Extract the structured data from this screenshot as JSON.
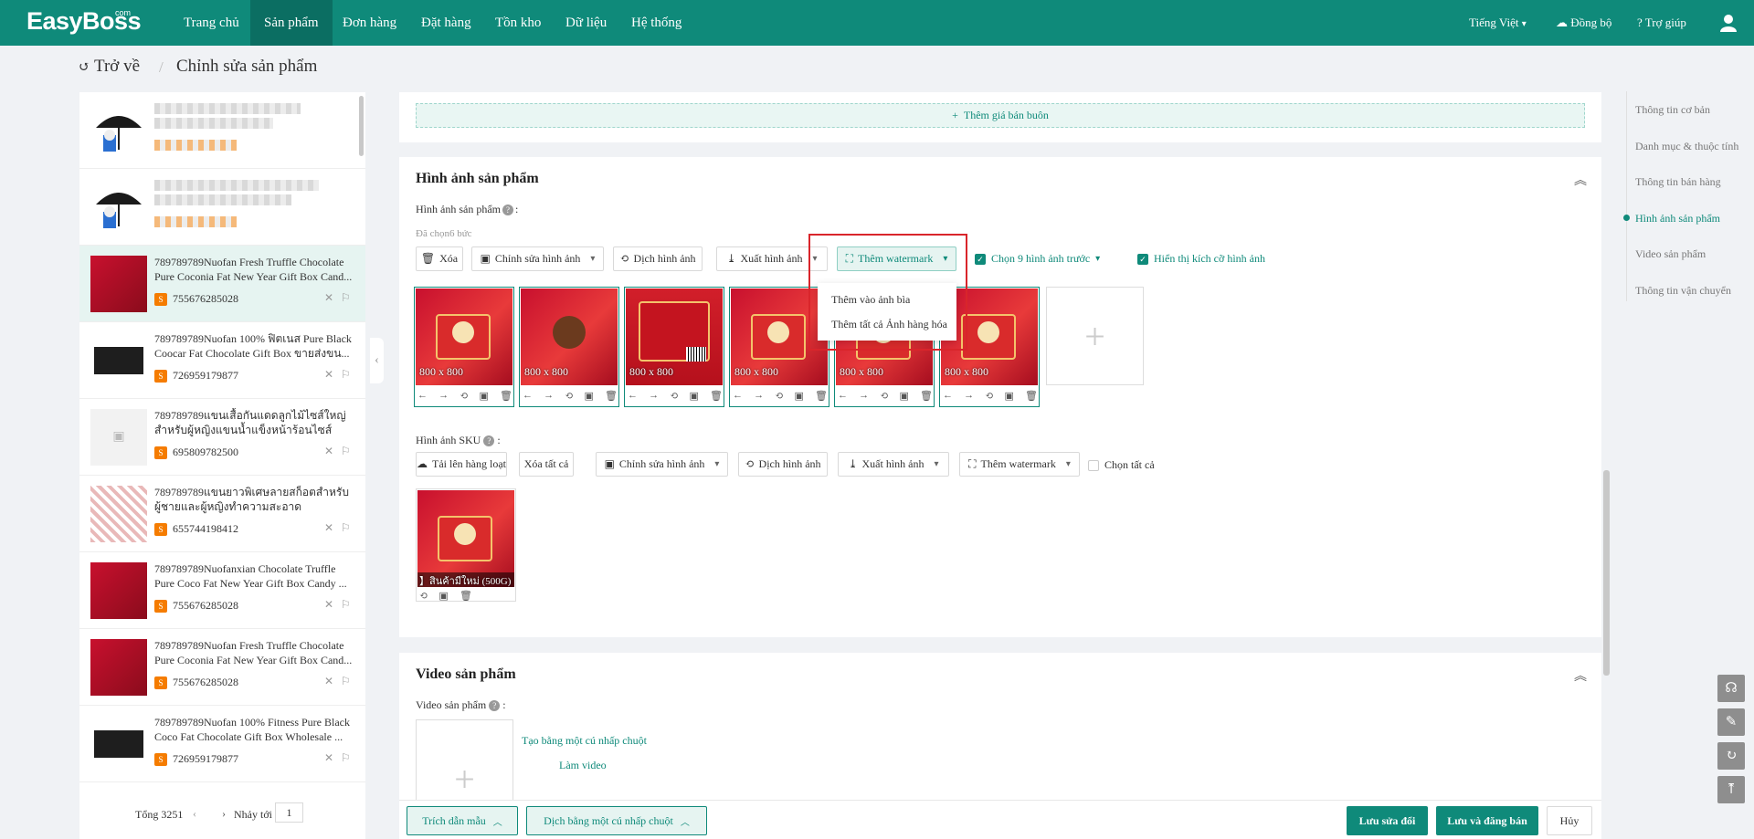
{
  "app": {
    "logo": "EasyBoss",
    "logo_suffix": "com",
    "nav": [
      "Trang chủ",
      "Sản phẩm",
      "Đơn hàng",
      "Đặt hàng",
      "Tồn kho",
      "Dữ liệu",
      "Hệ thống"
    ],
    "active_nav": "Sản phẩm",
    "language": "Tiếng Việt",
    "sync": "Đồng bộ",
    "help": "Trợ giúp"
  },
  "breadcrumb": {
    "back": "Trở về",
    "title": "Chỉnh sửa sản phẩm"
  },
  "product_list": {
    "items": [
      {
        "title": "789789789Nuofan Fresh Truffle Chocolate Pure Coconia Fat New Year Gift Box Cand...",
        "id": "755676285028"
      },
      {
        "title": "789789789Nuofan 100% ฟิตเนส Pure Black Coocar Fat Chocolate Gift Box ขายส่งขน...",
        "id": "726959179877"
      },
      {
        "title": "789789789แขนเสื้อกันแดดลูกไม้ไซส์ใหญ่สำหรับผู้หญิงแขนน้ำแข็งหน้าร้อนไซส์ใหญ่...",
        "id": "695809782500"
      },
      {
        "title": "789789789แขนยาวพิเศษลายสก็อตสำหรับผู้ชายและผู้หญิงทำความสะอาดสำนักงาน...",
        "id": "655744198412"
      },
      {
        "title": "789789789Nuofanxian Chocolate Truffle Pure Coco Fat New Year Gift Box Candy ...",
        "id": "755676285028"
      },
      {
        "title": "789789789Nuofan Fresh Truffle Chocolate Pure Coconia Fat New Year Gift Box Cand...",
        "id": "755676285028"
      },
      {
        "title": "789789789Nuofan 100% Fitness Pure Black Coco Fat Chocolate Gift Box Wholesale ...",
        "id": "726959179877"
      }
    ],
    "pager": {
      "total": "Tổng 3251",
      "goto": "Nhảy tới",
      "page": "1"
    }
  },
  "wholesale": {
    "add_label": "Thêm giá bán buôn"
  },
  "images_section": {
    "title": "Hình ảnh sản phẩm",
    "field_label": "Hình ảnh sản phẩm",
    "selected": "Đã chọn6 bức",
    "buttons": {
      "delete": "Xóa",
      "edit": "Chỉnh sửa hình ảnh",
      "translate": "Dịch hình ảnh",
      "export": "Xuất hình ảnh",
      "watermark": "Thêm watermark"
    },
    "choose_first": "Chọn 9 hình ảnh trước",
    "show_size": "Hiển thị kích cỡ hình ảnh",
    "thumb_size": "800 x 800",
    "watermark_menu": [
      "Thêm vào ảnh bìa",
      "Thêm tất cả Ảnh hàng hóa"
    ]
  },
  "sku_section": {
    "label": "Hình ảnh SKU",
    "buttons": {
      "upload": "Tải lên hàng loạt",
      "delete_all": "Xóa tất cả",
      "edit": "Chỉnh sửa hình ảnh",
      "translate": "Dịch hình ảnh",
      "export": "Xuất hình ảnh",
      "watermark": "Thêm watermark"
    },
    "select_all": "Chọn tất cả",
    "sku_caption": "】สินค้ามีใหม่ (500G)"
  },
  "video_section": {
    "title": "Video sản phẩm",
    "field_label": "Video sản phẩm",
    "one_click": "Tạo bằng một cú nhấp chuột",
    "make_video": "Làm video"
  },
  "anchors": [
    "Thông tin cơ bản",
    "Danh mục & thuộc tính",
    "Thông tin bán hàng",
    "Hình ảnh sản phẩm",
    "Video sản phẩm",
    "Thông tin vận chuyển"
  ],
  "active_anchor": "Hình ảnh sản phẩm",
  "bottom_bar": {
    "template": "Trích dẫn mẫu",
    "translate": "Dịch bằng một cú nhấp chuột",
    "save": "Lưu sửa đổi",
    "save_publish": "Lưu và đăng bán",
    "cancel": "Hủy"
  },
  "colors": {
    "brand": "#0f8a7a",
    "highlight": "#d9252b"
  }
}
